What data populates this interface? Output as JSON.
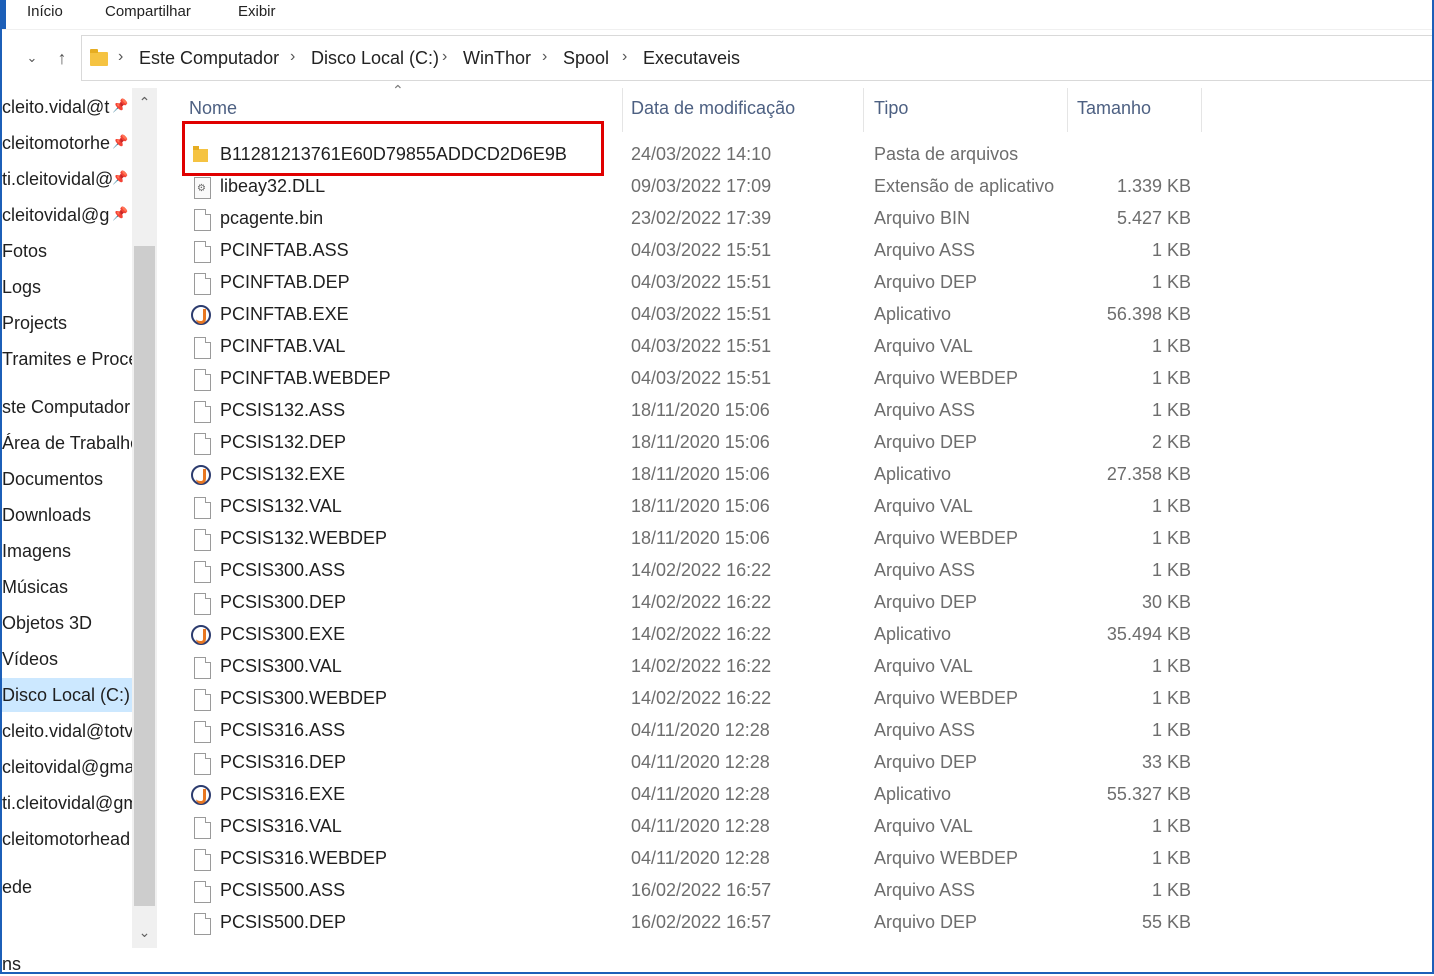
{
  "ribbon": {
    "tabs": [
      "Início",
      "Compartilhar",
      "Exibir"
    ]
  },
  "address": {
    "crumbs": [
      "Este Computador",
      "Disco Local (C:)",
      "WinThor",
      "Spool",
      "Executaveis"
    ]
  },
  "sidebar": {
    "items": [
      {
        "label": "cleito.vidal@t",
        "pinned": true
      },
      {
        "label": "cleitomotorhe",
        "pinned": true
      },
      {
        "label": "ti.cleitovidal@",
        "pinned": true
      },
      {
        "label": "cleitovidal@g",
        "pinned": true
      },
      {
        "label": "Fotos"
      },
      {
        "label": "Logs"
      },
      {
        "label": "Projects"
      },
      {
        "label": "Tramites e Proce"
      },
      {
        "label": "ste Computador"
      },
      {
        "label": "Área de Trabalho"
      },
      {
        "label": "Documentos"
      },
      {
        "label": "Downloads"
      },
      {
        "label": "Imagens"
      },
      {
        "label": "Músicas"
      },
      {
        "label": "Objetos 3D"
      },
      {
        "label": "Vídeos"
      },
      {
        "label": "Disco Local (C:)",
        "selected": true
      },
      {
        "label": "cleito.vidal@totv"
      },
      {
        "label": "cleitovidal@gma"
      },
      {
        "label": "ti.cleitovidal@gm"
      },
      {
        "label": "cleitomotorhead"
      },
      {
        "label": "ede"
      },
      {
        "label": "ns"
      }
    ]
  },
  "columns": {
    "name": "Nome",
    "date": "Data de modificação",
    "type": "Tipo",
    "size": "Tamanho"
  },
  "files": [
    {
      "name": "B11281213761E60D79855ADDCD2D6E9B",
      "date": "24/03/2022 14:10",
      "type": "Pasta de arquivos",
      "size": "",
      "icon": "folder-icon"
    },
    {
      "name": "libeay32.DLL",
      "date": "09/03/2022 17:09",
      "type": "Extensão de aplicativo",
      "size": "1.339 KB",
      "icon": "dll-icon"
    },
    {
      "name": "pcagente.bin",
      "date": "23/02/2022 17:39",
      "type": "Arquivo BIN",
      "size": "5.427 KB",
      "icon": "file-icon"
    },
    {
      "name": "PCINFTAB.ASS",
      "date": "04/03/2022 15:51",
      "type": "Arquivo ASS",
      "size": "1 KB",
      "icon": "file-icon"
    },
    {
      "name": "PCINFTAB.DEP",
      "date": "04/03/2022 15:51",
      "type": "Arquivo DEP",
      "size": "1 KB",
      "icon": "file-icon"
    },
    {
      "name": "PCINFTAB.EXE",
      "date": "04/03/2022 15:51",
      "type": "Aplicativo",
      "size": "56.398 KB",
      "icon": "app-icon"
    },
    {
      "name": "PCINFTAB.VAL",
      "date": "04/03/2022 15:51",
      "type": "Arquivo VAL",
      "size": "1 KB",
      "icon": "file-icon"
    },
    {
      "name": "PCINFTAB.WEBDEP",
      "date": "04/03/2022 15:51",
      "type": "Arquivo WEBDEP",
      "size": "1 KB",
      "icon": "file-icon"
    },
    {
      "name": "PCSIS132.ASS",
      "date": "18/11/2020 15:06",
      "type": "Arquivo ASS",
      "size": "1 KB",
      "icon": "file-icon"
    },
    {
      "name": "PCSIS132.DEP",
      "date": "18/11/2020 15:06",
      "type": "Arquivo DEP",
      "size": "2 KB",
      "icon": "file-icon"
    },
    {
      "name": "PCSIS132.EXE",
      "date": "18/11/2020 15:06",
      "type": "Aplicativo",
      "size": "27.358 KB",
      "icon": "app-icon"
    },
    {
      "name": "PCSIS132.VAL",
      "date": "18/11/2020 15:06",
      "type": "Arquivo VAL",
      "size": "1 KB",
      "icon": "file-icon"
    },
    {
      "name": "PCSIS132.WEBDEP",
      "date": "18/11/2020 15:06",
      "type": "Arquivo WEBDEP",
      "size": "1 KB",
      "icon": "file-icon"
    },
    {
      "name": "PCSIS300.ASS",
      "date": "14/02/2022 16:22",
      "type": "Arquivo ASS",
      "size": "1 KB",
      "icon": "file-icon"
    },
    {
      "name": "PCSIS300.DEP",
      "date": "14/02/2022 16:22",
      "type": "Arquivo DEP",
      "size": "30 KB",
      "icon": "file-icon"
    },
    {
      "name": "PCSIS300.EXE",
      "date": "14/02/2022 16:22",
      "type": "Aplicativo",
      "size": "35.494 KB",
      "icon": "app-icon"
    },
    {
      "name": "PCSIS300.VAL",
      "date": "14/02/2022 16:22",
      "type": "Arquivo VAL",
      "size": "1 KB",
      "icon": "file-icon"
    },
    {
      "name": "PCSIS300.WEBDEP",
      "date": "14/02/2022 16:22",
      "type": "Arquivo WEBDEP",
      "size": "1 KB",
      "icon": "file-icon"
    },
    {
      "name": "PCSIS316.ASS",
      "date": "04/11/2020 12:28",
      "type": "Arquivo ASS",
      "size": "1 KB",
      "icon": "file-icon"
    },
    {
      "name": "PCSIS316.DEP",
      "date": "04/11/2020 12:28",
      "type": "Arquivo DEP",
      "size": "33 KB",
      "icon": "file-icon"
    },
    {
      "name": "PCSIS316.EXE",
      "date": "04/11/2020 12:28",
      "type": "Aplicativo",
      "size": "55.327 KB",
      "icon": "app-icon"
    },
    {
      "name": "PCSIS316.VAL",
      "date": "04/11/2020 12:28",
      "type": "Arquivo VAL",
      "size": "1 KB",
      "icon": "file-icon"
    },
    {
      "name": "PCSIS316.WEBDEP",
      "date": "04/11/2020 12:28",
      "type": "Arquivo WEBDEP",
      "size": "1 KB",
      "icon": "file-icon"
    },
    {
      "name": "PCSIS500.ASS",
      "date": "16/02/2022 16:57",
      "type": "Arquivo ASS",
      "size": "1 KB",
      "icon": "file-icon"
    },
    {
      "name": "PCSIS500.DEP",
      "date": "16/02/2022 16:57",
      "type": "Arquivo DEP",
      "size": "55 KB",
      "icon": "file-icon"
    }
  ],
  "highlight_color": "#e00000",
  "selection_color": "#cce8ff"
}
